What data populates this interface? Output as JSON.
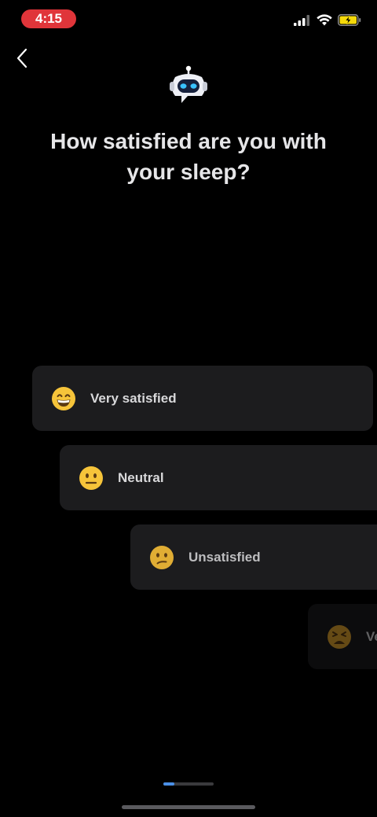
{
  "status_bar": {
    "time": "4:15",
    "icons": [
      "cellular-signal-icon",
      "wifi-icon",
      "battery-charging-icon"
    ]
  },
  "header": {
    "back_icon": "chevron-left-icon",
    "mascot_icon": "robot-icon"
  },
  "question": {
    "title": "How satisfied are you with your sleep?"
  },
  "options": [
    {
      "label": "Very satisfied",
      "icon": "grinning-face-emoji"
    },
    {
      "label": "Neutral",
      "icon": "neutral-face-emoji"
    },
    {
      "label": "Unsatisfied",
      "icon": "confused-face-emoji"
    },
    {
      "label": "Ve",
      "icon": "weary-face-emoji"
    }
  ],
  "progress": {
    "fraction": 0.22
  },
  "colors": {
    "background": "#000000",
    "card": "#1c1c1e",
    "accent": "#4a8fe6",
    "time_pill": "#e0353a",
    "battery": "#f5d90a"
  }
}
